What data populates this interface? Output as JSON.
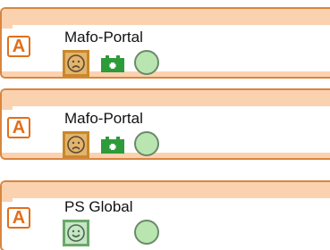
{
  "items": [
    {
      "name": "Mafo-Portal",
      "badge_letter": "A",
      "mood": "sad",
      "has_battery": true,
      "status_color": "#b9e6b0"
    },
    {
      "name": "Mafo-Portal",
      "badge_letter": "A",
      "mood": "sad",
      "has_battery": true,
      "status_color": "#b9e6b0"
    },
    {
      "name": "PS Global",
      "badge_letter": "A",
      "mood": "happy",
      "has_battery": false,
      "status_color": "#b9e6b0"
    }
  ],
  "colors": {
    "card_border": "#d9853f",
    "card_band": "#fbd2b0",
    "badge_orange": "#e06f1a",
    "battery_green": "#2e9b3a"
  },
  "icons": {
    "badge": "letter-a-badge-icon",
    "sad": "sad-face-icon",
    "happy": "happy-face-icon",
    "battery": "battery-icon",
    "status": "status-circle-icon"
  }
}
